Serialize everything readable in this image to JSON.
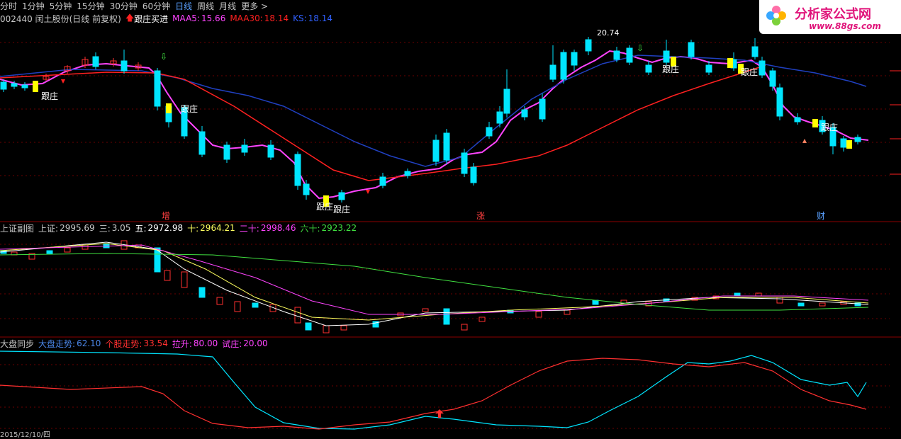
{
  "toolbar": {
    "items": [
      "分时",
      "1分钟",
      "5分钟",
      "15分钟",
      "30分钟",
      "60分钟",
      "日线",
      "周线",
      "月线",
      "更多 >"
    ],
    "active": "日线"
  },
  "main": {
    "stock": "002440 闰土股份(日线 前复权)",
    "signal": "跟庄买进",
    "ma5": {
      "label": "MAA5:",
      "value": "15.66",
      "color": "#ff44ff"
    },
    "ma30": {
      "label": "MAA30:",
      "value": "18.14",
      "color": "#ff2020"
    },
    "ks": {
      "label": "KS:",
      "value": "18.14",
      "color": "#3060ff"
    },
    "peak": "20.74",
    "tags": [
      "跟庄",
      "跟庄",
      "跟庄",
      "跟庄",
      "跟庄",
      "跟庄",
      "跟庄"
    ],
    "markers": [
      "增",
      "涨",
      "财"
    ]
  },
  "index_panel": {
    "name": "上证副图",
    "close": {
      "label": "上证:",
      "value": "2995.69"
    },
    "ma3": {
      "label": "三:",
      "value": "3.05"
    },
    "ma5": {
      "label": "五:",
      "value": "2972.98"
    },
    "ma10": {
      "label": "十:",
      "value": "2964.21"
    },
    "ma20": {
      "label": "二十:",
      "value": "2998.46"
    },
    "ma60": {
      "label": "六十:",
      "value": "2923.22"
    }
  },
  "sync_panel": {
    "name": "大盘同步",
    "market": {
      "label": "大盘走势:",
      "value": "62.10",
      "color": "#4a86e8"
    },
    "stock": {
      "label": "个股走势:",
      "value": "33.54",
      "color": "#ff3030"
    },
    "pull": {
      "label": "拉升:",
      "value": "80.00",
      "color": "#ff44ff"
    },
    "test": {
      "label": "试庄:",
      "value": "20.00",
      "color": "#ff44ff"
    }
  },
  "logo": {
    "brand": "分析家公式网",
    "url": "www.88gs.com"
  },
  "footer": {
    "date": "2015/12/10/四"
  },
  "colors": {
    "up": "#ff3030",
    "down": "#00e5ff",
    "ma5": "#ff44ff",
    "ma30": "#ff2020",
    "ks": "#2040c0",
    "signal": "#ffff00"
  }
}
